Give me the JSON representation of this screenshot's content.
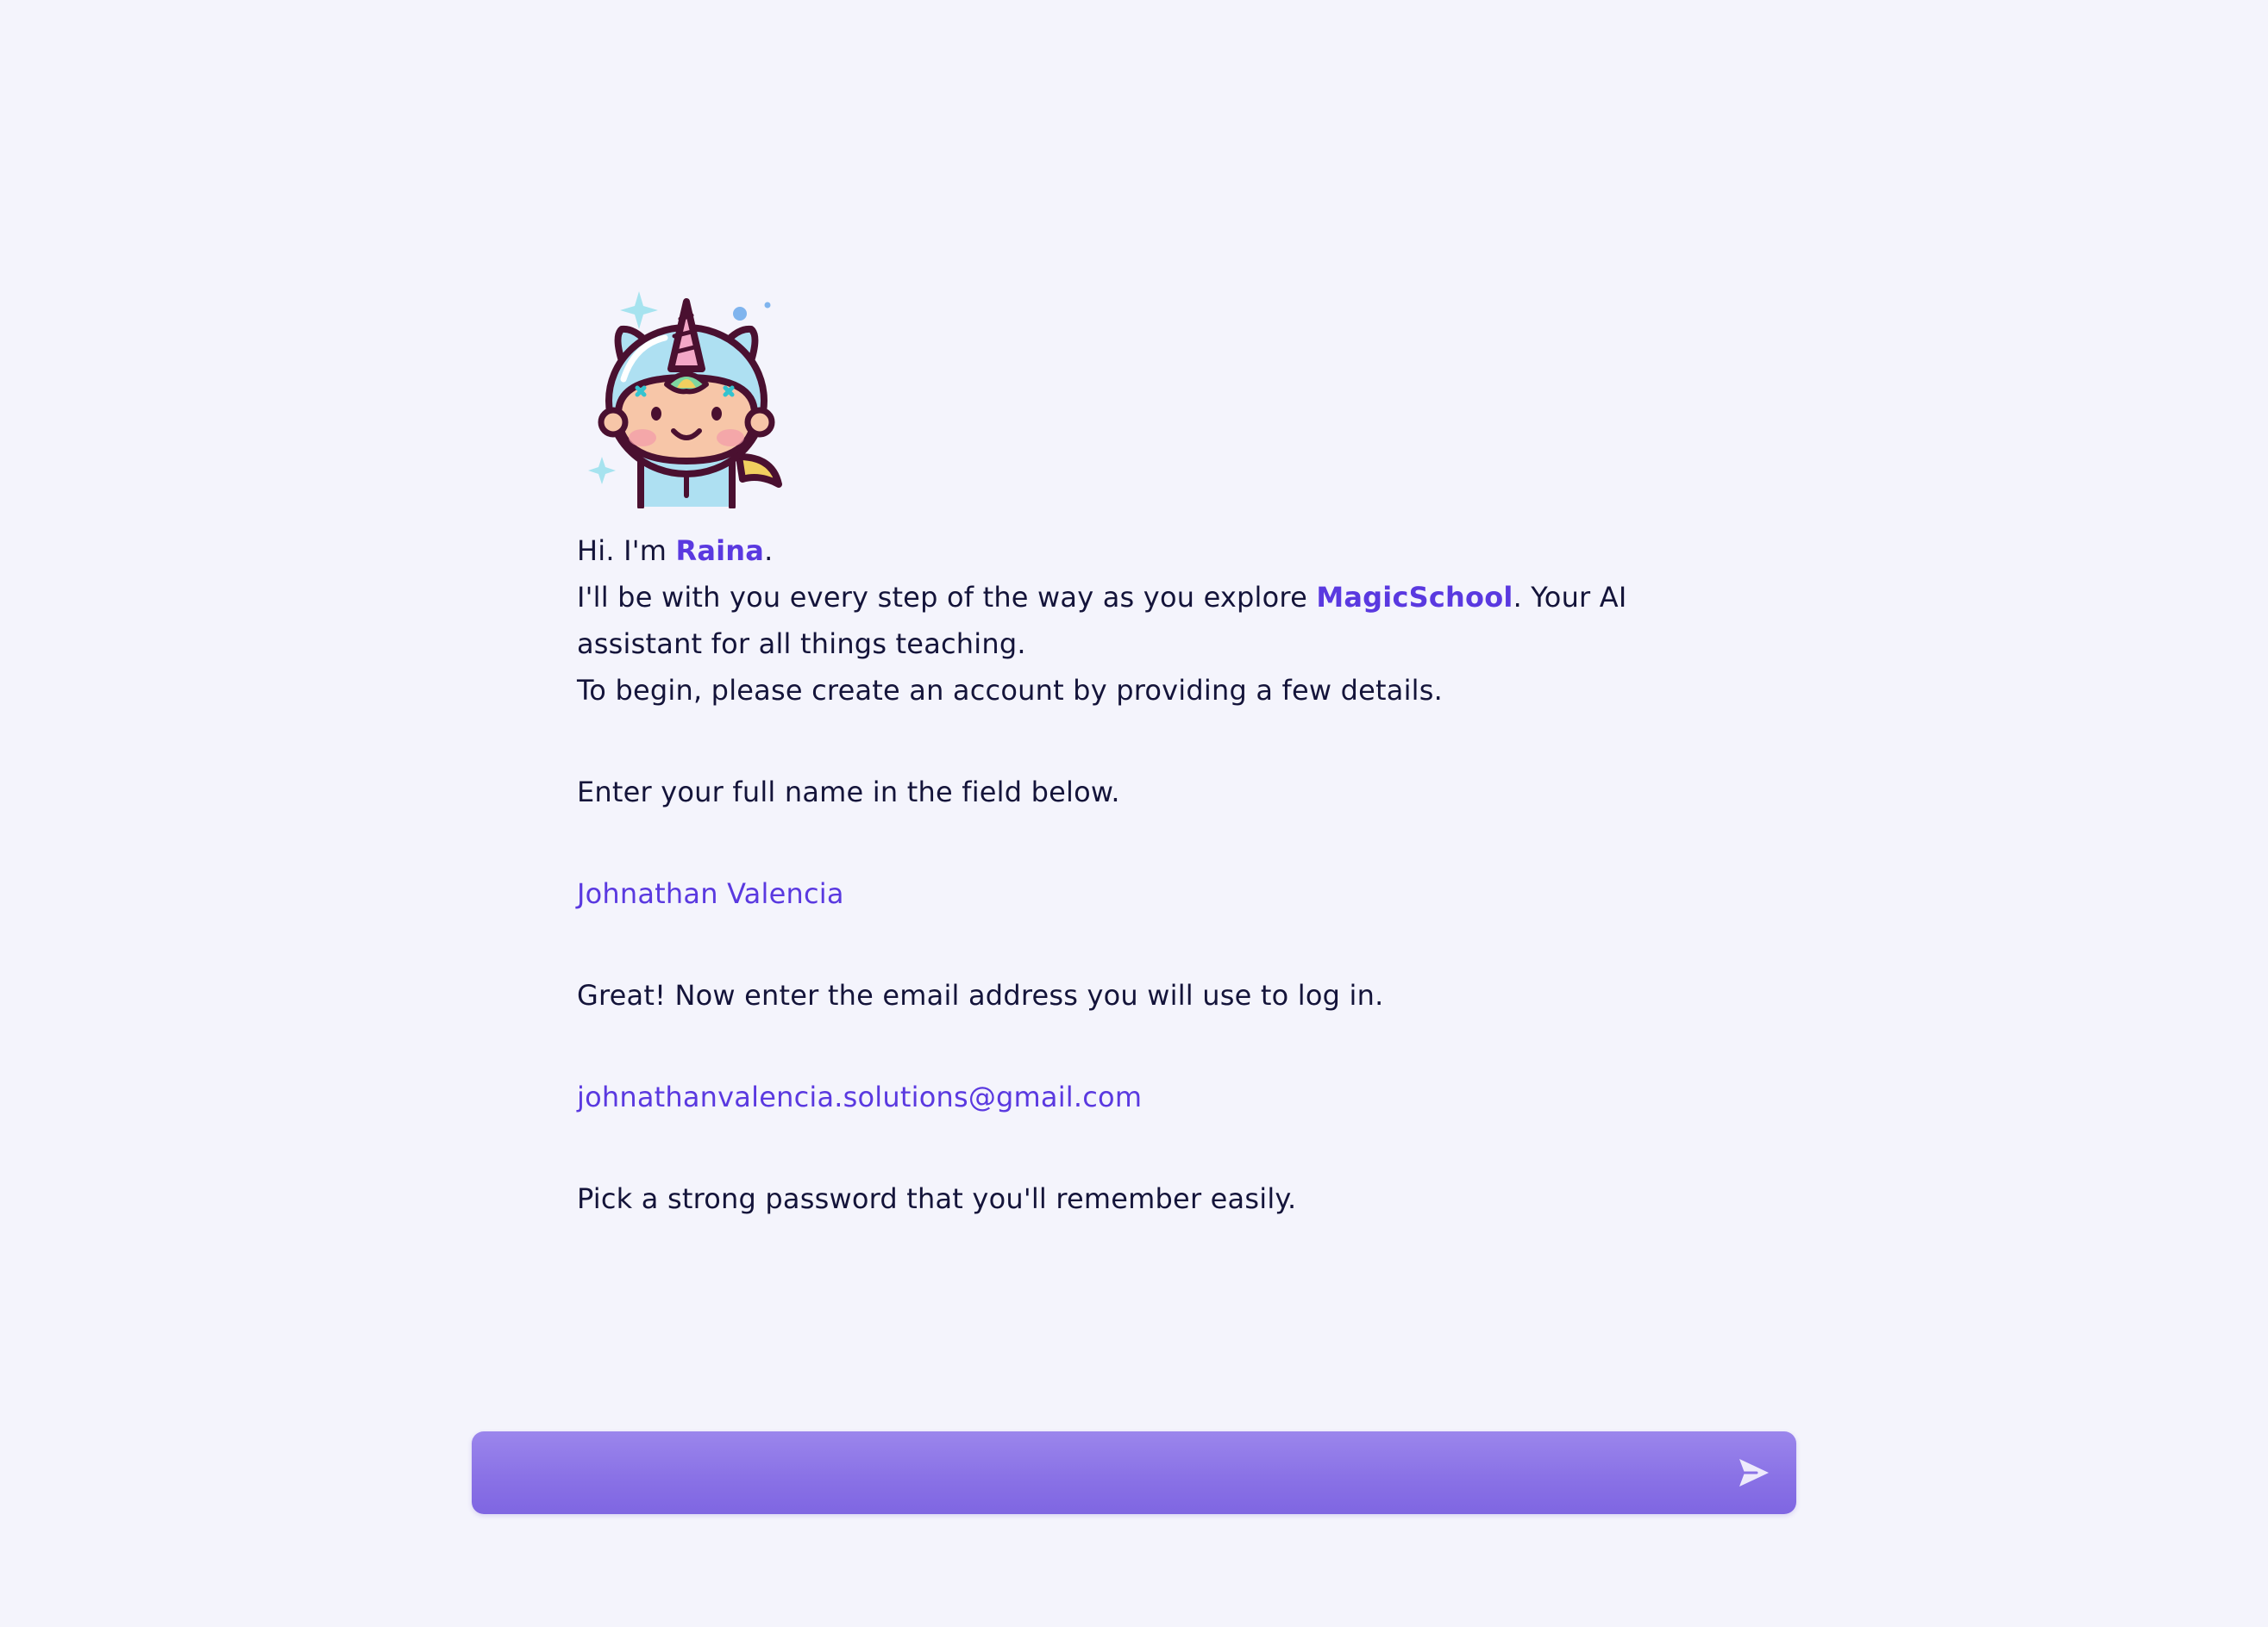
{
  "assistant": {
    "greeting_prefix": "Hi. I'm ",
    "name": "Raina",
    "greeting_suffix": ".",
    "intro_prefix": "I'll be with you every step of the way as you explore ",
    "brand": "MagicSchool",
    "intro_suffix": ". Your AI assistant for all things teaching.",
    "intro_line3": "To begin, please create an account by providing a few details."
  },
  "conversation": [
    {
      "role": "bot",
      "text": "Enter your full name in the field below."
    },
    {
      "role": "user",
      "text": "Johnathan Valencia"
    },
    {
      "role": "bot",
      "text": "Great! Now enter the email address you will use to log in."
    },
    {
      "role": "user",
      "text": "johnathanvalencia.solutions@gmail.com"
    },
    {
      "role": "bot",
      "text": "Pick a strong password that you'll remember easily."
    }
  ],
  "composer": {
    "value": "",
    "placeholder": "",
    "send_icon": "send-icon"
  },
  "colors": {
    "background": "#f4f4fc",
    "accent": "#5a39e0",
    "composer": "#8a72e6"
  }
}
